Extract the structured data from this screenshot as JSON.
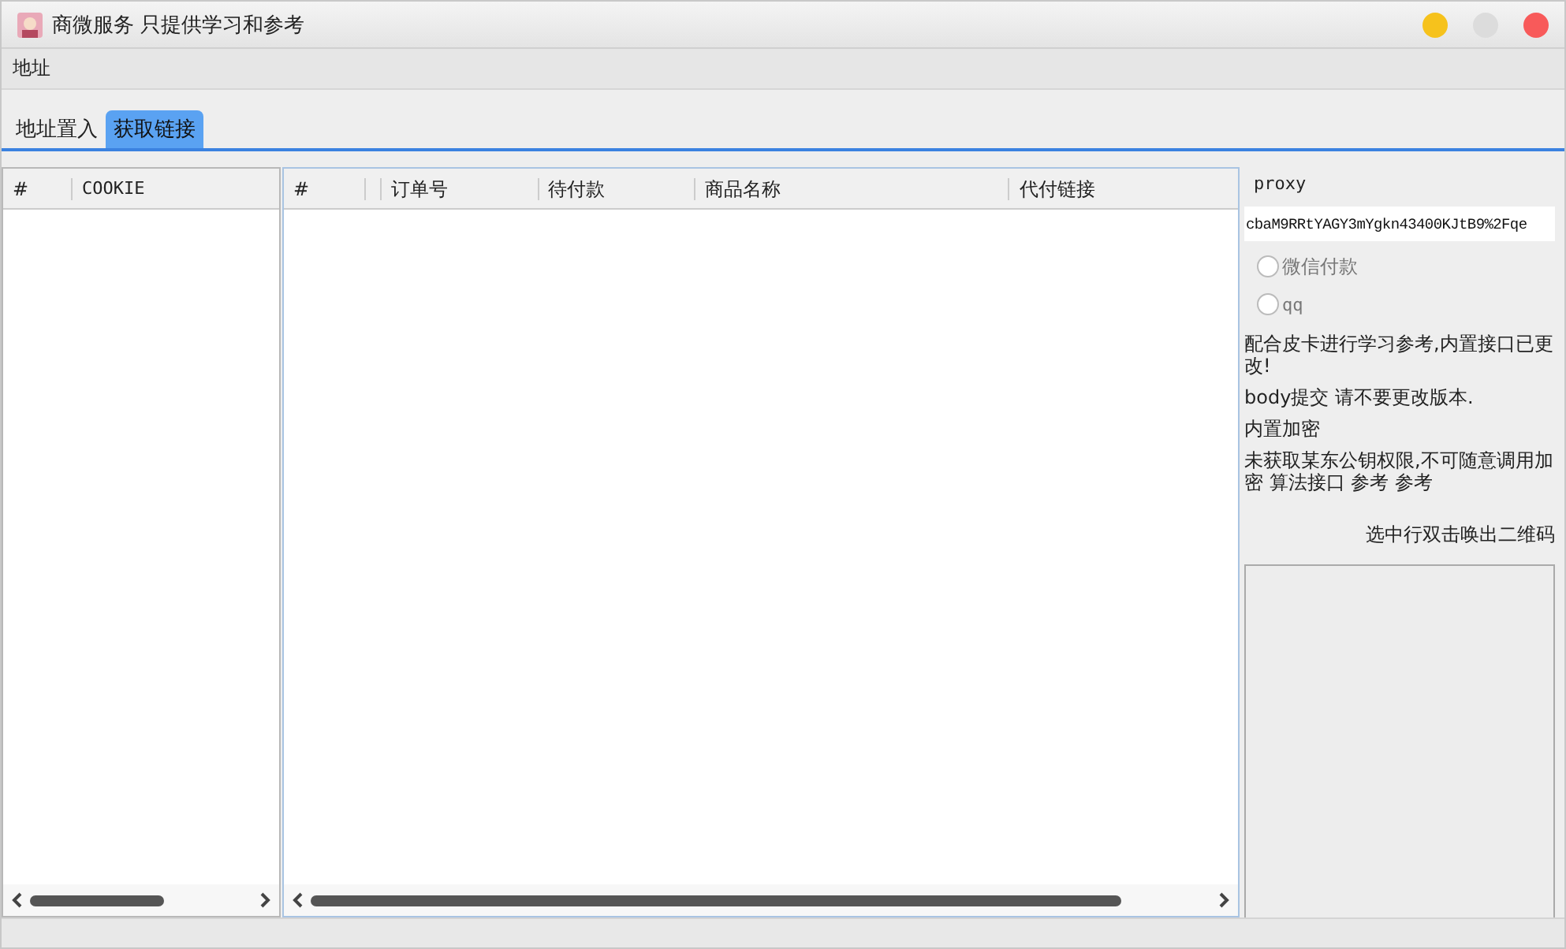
{
  "window": {
    "title": "商微服务 只提供学习和参考"
  },
  "menu": [
    "地址"
  ],
  "tabs": [
    {
      "label": "地址置入",
      "selected": false
    },
    {
      "label": "获取链接",
      "selected": true
    }
  ],
  "cookie_table": {
    "columns": [
      "#",
      "COOKIE"
    ]
  },
  "order_table": {
    "columns": [
      "#",
      "",
      "订单号",
      "待付款",
      "商品名称",
      "代付链接"
    ]
  },
  "side": {
    "proxy_label": "proxy",
    "proxy_value": "cbaM9RRtYAGY3mYgkn43400KJtB9%2Fqe",
    "payment_options": [
      {
        "label": "微信付款",
        "selected": false
      },
      {
        "label": "qq",
        "selected": false
      }
    ],
    "notes": [
      "配合皮卡进行学习参考,内置接口已更改!",
      "body提交 请不要更改版本.",
      "内置加密",
      "未获取某东公钥权限,不可随意调用加密 算法接口 参考 参考"
    ],
    "qr_hint": "选中行双击唤出二维码"
  }
}
